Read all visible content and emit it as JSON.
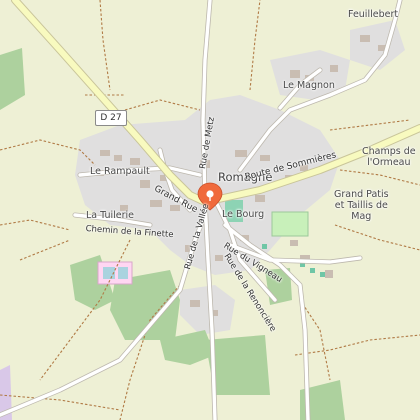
{
  "map": {
    "colors": {
      "background": "#f2efe9",
      "farmland": "#eef0d5",
      "residential": "#e0dfdf",
      "forest": "#add19e",
      "major_road": "#f8fabf",
      "road_casing": "#c9c59a",
      "minor_road": "#ffffff",
      "path": "#b07a45",
      "marker": "#f06a3c"
    },
    "road_shield": "D 27",
    "places": {
      "feuillebert": "Feuillebert",
      "le_magnon": "Le Magnon",
      "le_rampault": "Le Rampault",
      "romagne": "Romagne",
      "champs_de_lormeau": "Champs de\nl'Ormeau",
      "grand_patis": "Grand Patis\net Taillis de\nMag",
      "la_tuilerie": "La Tuilerie",
      "le_bourg": "Le Bourg"
    },
    "streets": {
      "route_de_sommieres": "Route de Sommières",
      "grand_rue": "Grand Rue",
      "rue_de_metz": "Rue de Metz",
      "chemin_de_la_finette": "Chemin de la Finette",
      "rue_de_la_vallee": "Rue de la Vallée",
      "rue_du_vigneau": "Rue du Vigneau",
      "rue_de_la_renonciere": "Rue de la Renoncière"
    },
    "marker_icon": "location-pin-icon"
  }
}
